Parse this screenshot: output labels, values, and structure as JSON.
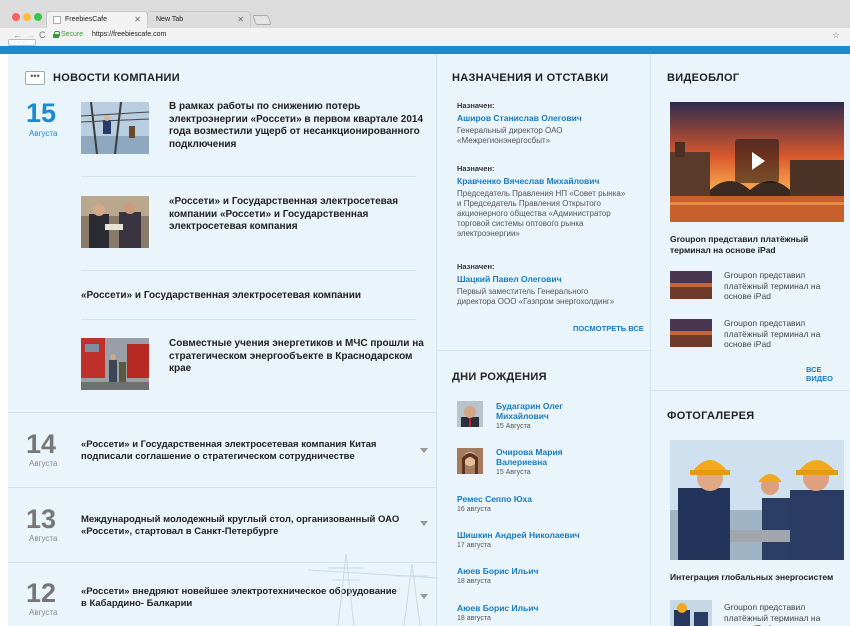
{
  "browser": {
    "tabs": [
      {
        "title": "FreebiesCafe",
        "active": true
      },
      {
        "title": "New Tab",
        "active": false
      }
    ],
    "secure_label": "Secure",
    "url": "https://freebiescafe.com"
  },
  "news": {
    "title": "НОВОСТИ КОМПАНИИ",
    "featured_day": "15",
    "featured_month": "Августа",
    "items": [
      {
        "title": "В рамках работы по снижению потерь электроэнергии «Россети» в первом квартале 2014 года возместили ущерб от несанкционированного подключения"
      },
      {
        "title": "«Россети» и Государственная электросетевая компании «Россети» и Государственная электросетевая компания"
      },
      {
        "title": "«Россети» и Государственная электросетевая компании"
      },
      {
        "title": "Совместные учения энергетиков и МЧС прошли на стратегическом энергообъекте в Краснодарском крае"
      }
    ],
    "archive": [
      {
        "day": "14",
        "month": "Августа",
        "title": "«Россети» и Государственная электросетевая компания Китая подписали соглашение о стратегическом сотрудничестве"
      },
      {
        "day": "13",
        "month": "Августа",
        "title": "Международный молодежный круглый стол, организованный ОАО «Россети», стартовал в Санкт-Петербурге"
      },
      {
        "day": "12",
        "month": "Августа",
        "title": "«Россети» внедряют новейшее электротехническое оборудование в Кабардино- Балкарии"
      }
    ]
  },
  "appointments": {
    "title": "НАЗНАЧЕНИЯ И ОТСТАВКИ",
    "items": [
      {
        "label": "Назначен:",
        "name": "Аширов Станислав Олегович",
        "desc": "Генеральный директор ОАО «Межрегионэнергосбыт»"
      },
      {
        "label": "Назначен:",
        "name": "Кравченко Вячеслав Михайлович",
        "desc": "Председатель Правления НП «Совет рынка» и Председатель Правления Открытого акционерного общества «Администратор торговой системы оптового рынка электроэнергии»"
      },
      {
        "label": "Назначен:",
        "name": "Шацкий Павел Олегович",
        "desc": "Первый заместитель Генерального директора ООО «Газпром энергохолдинг»"
      }
    ],
    "see_all": "ПОСМОТРЕТЬ ВСЕ"
  },
  "birthdays": {
    "title": "ДНИ РОЖДЕНИЯ",
    "items": [
      {
        "name": "Будагарин Олег Михайлович",
        "date": "15 Августа"
      },
      {
        "name": "Очирова Мария Валериевна",
        "date": "15 Августа"
      },
      {
        "name": "Ремес Сеппо Юха",
        "date": "16 августа"
      },
      {
        "name": "Шишкин Андрей Николаевич",
        "date": "17 августа"
      },
      {
        "name": "Аюев Борис Ильич",
        "date": "18 августа"
      },
      {
        "name": "Аюев Борис Ильич",
        "date": "18 августа"
      }
    ]
  },
  "videoblog": {
    "title": "ВИДЕОБЛОГ",
    "main_caption": "Groupon представил платёжный терминал на основе iPad",
    "items": [
      {
        "caption": "Groupon представил платёжный терминал на основе iPad"
      },
      {
        "caption": "Groupon представил платёжный терминал на основе iPad"
      }
    ],
    "all_link": "ВСЕ ВИДЕО"
  },
  "gallery": {
    "title": "ФОТОГАЛЕРЕЯ",
    "main_caption": "Интеграция глобальных энергосистем",
    "items": [
      {
        "caption": "Groupon представил платёжный терминал на основе iPad"
      }
    ]
  },
  "colors": {
    "accent": "#1a8bd0",
    "link": "#1a7bc4",
    "page_bg": "#eaf4fb"
  }
}
